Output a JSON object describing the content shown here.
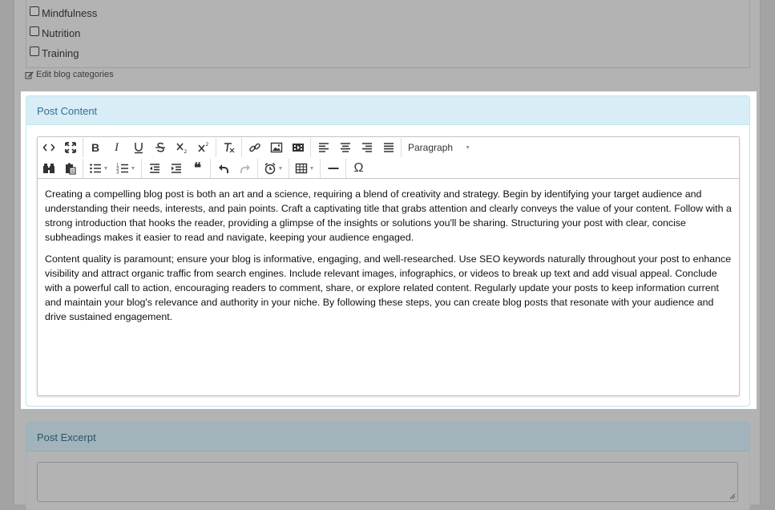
{
  "categories": [
    {
      "label": "Mindfulness",
      "checked": false
    },
    {
      "label": "Nutrition",
      "checked": false
    },
    {
      "label": "Training",
      "checked": false
    }
  ],
  "edit_categories_label": "Edit blog categories",
  "post_content": {
    "heading": "Post Content",
    "toolbar": {
      "format_select": "Paragraph",
      "row1_icons": [
        "code-icon",
        "fullscreen-icon",
        "bold-icon",
        "italic-icon",
        "underline-icon",
        "strikethrough-icon",
        "subscript-icon",
        "superscript-icon",
        "clear-format-icon",
        "link-icon",
        "image-icon",
        "media-icon",
        "align-left-icon",
        "align-center-icon",
        "align-right-icon",
        "align-justify-icon"
      ],
      "row2_icons": [
        "find-replace-icon",
        "paste-text-icon",
        "bullet-list-icon",
        "numbered-list-icon",
        "outdent-icon",
        "indent-icon",
        "blockquote-icon",
        "undo-icon",
        "redo-icon",
        "insert-time-icon",
        "table-icon",
        "horizontal-rule-icon",
        "special-char-icon"
      ]
    },
    "paragraphs": [
      "Creating a compelling blog post is both an art and a science, requiring a blend of creativity and strategy. Begin by identifying your target audience and understanding their needs, interests, and pain points. Craft a captivating title that grabs attention and clearly conveys the value of your content. Follow with a strong introduction that hooks the reader, providing a glimpse of the insights or solutions you'll be sharing. Structuring your post with clear, concise subheadings makes it easier to read and navigate, keeping your audience engaged.",
      "Content quality is paramount; ensure your blog is informative, engaging, and well-researched. Use SEO keywords naturally throughout your post to enhance visibility and attract organic traffic from search engines. Include relevant images, infographics, or videos to break up text and add visual appeal. Conclude with a powerful call to action, encouraging readers to comment, share, or explore related content. Regularly update your posts to keep information current and maintain your blog's relevance and authority in your niche. By following these steps, you can create blog posts that resonate with your audience and drive sustained engagement."
    ]
  },
  "post_excerpt": {
    "heading": "Post Excerpt",
    "value": ""
  },
  "colors": {
    "panel_heading_bg": "#d9edf7",
    "panel_heading_text": "#31708f",
    "panel_border": "#bce8f1"
  }
}
